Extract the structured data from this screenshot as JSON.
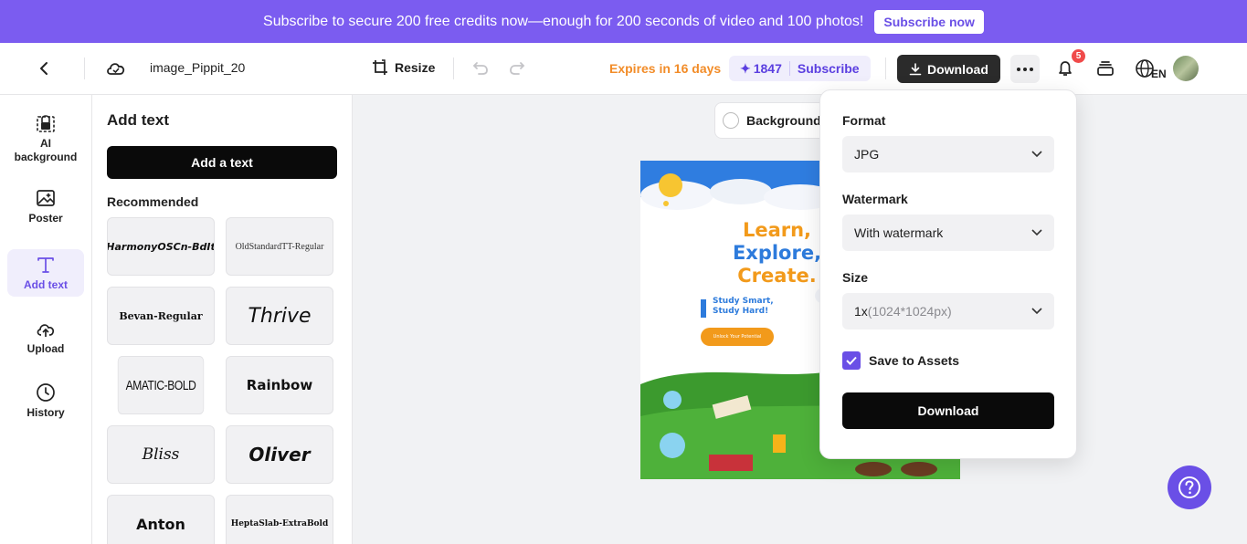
{
  "banner": {
    "text": "Subscribe to secure 200 free credits now—enough for 200 seconds of video and 100 photos!",
    "button": "Subscribe now"
  },
  "topbar": {
    "filename": "image_Pippit_20",
    "resize_label": "Resize",
    "expires": "Expires in 16 days",
    "credits": "1847",
    "subscribe_label": "Subscribe",
    "download_label": "Download",
    "notification_count": "5",
    "language": "EN"
  },
  "leftnav": {
    "items": [
      {
        "label": "AI background"
      },
      {
        "label": "Poster"
      },
      {
        "label": "Add text"
      },
      {
        "label": "Upload"
      },
      {
        "label": "History"
      }
    ]
  },
  "panel": {
    "title": "Add text",
    "add_button": "Add a text",
    "recommended_label": "Recommended",
    "fonts": [
      "HarmonyOSCn-BdIt",
      "OldStandardTT-Regular",
      "Bevan-Regular",
      "Thrive",
      "AMATIC-BOLD",
      "Rainbow",
      "Bliss",
      "Oliver",
      "Anton",
      "HeptaSlab-ExtraBold"
    ]
  },
  "canvas": {
    "background_label": "Background",
    "poster": {
      "line1": "Learn,",
      "line2": "Explore,",
      "line3": "Create.",
      "tagline1": "Study Smart,",
      "tagline2": "Study Hard!",
      "cta": "Unlock Your Potential"
    }
  },
  "download_popup": {
    "format_label": "Format",
    "format_value": "JPG",
    "watermark_label": "Watermark",
    "watermark_value": "With watermark",
    "size_label": "Size",
    "size_value": "1x",
    "size_detail": "(1024*1024px)",
    "save_to_assets_label": "Save to Assets",
    "save_to_assets_checked": true,
    "download_button": "Download"
  },
  "colors": {
    "brand": "#7b5cf0",
    "accent": "#6a4fe6",
    "expires": "#f28c28"
  }
}
